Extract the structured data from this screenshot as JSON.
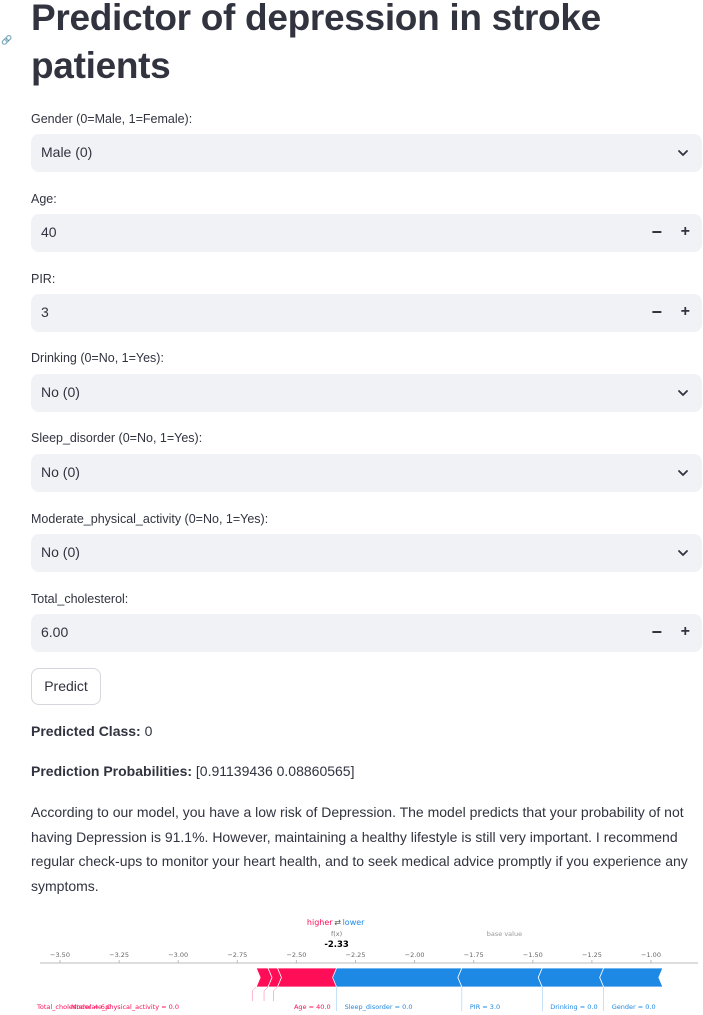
{
  "page": {
    "title": "Predictor of depression in stroke patients"
  },
  "form": {
    "gender": {
      "label": "Gender (0=Male, 1=Female):",
      "value": "Male (0)"
    },
    "age": {
      "label": "Age:",
      "value": "40"
    },
    "pir": {
      "label": "PIR:",
      "value": "3"
    },
    "drinking": {
      "label": "Drinking (0=No, 1=Yes):",
      "value": "No (0)"
    },
    "sleep_disorder": {
      "label": "Sleep_disorder (0=No, 1=Yes):",
      "value": "No (0)"
    },
    "moderate_physical_activity": {
      "label": "Moderate_physical_activity (0=No, 1=Yes):",
      "value": "No (0)"
    },
    "total_cholesterol": {
      "label": "Total_cholesterol:",
      "value": "6.00"
    },
    "stepper_minus": "−",
    "stepper_plus": "+",
    "predict_label": "Predict"
  },
  "result": {
    "class_label": "Predicted Class:",
    "class_value": "0",
    "prob_label": "Prediction Probabilities:",
    "prob_value": "[0.91139436 0.08860565]",
    "advice": "According to our model, you have a low risk of Depression. The model predicts that your probability of not having Depression is 91.1%. However, maintaining a healthy lifestyle is still very important. I recommend regular check-ups to monitor your heart health, and to seek medical advice promptly if you experience any symptoms."
  },
  "chart_data": {
    "type": "force",
    "higher_label": "higher",
    "lower_label": "lower",
    "arrows": "⇄",
    "fx_label": "f(x)",
    "fx_value": "-2.33",
    "base_value_label": "base value",
    "ticks": [
      "−3.50",
      "−3.25",
      "−3.00",
      "−2.75",
      "−2.50",
      "−2.25",
      "−2.00",
      "−1.75",
      "−1.50",
      "−1.25",
      "−1.00"
    ],
    "tick_values": [
      -3.5,
      -3.25,
      -3.0,
      -2.75,
      -2.5,
      -2.25,
      -2.0,
      -1.75,
      -1.5,
      -1.25,
      -1.0
    ],
    "xlim": [
      -3.5,
      -1.0
    ],
    "fx": -2.33,
    "positive_color": "#ff0d57",
    "negative_color": "#1e88e5",
    "features": [
      {
        "label": "Total_cholesterol = 6.0",
        "start": -2.67,
        "end": -2.62,
        "sign": "positive"
      },
      {
        "label": "Moderate_physical_activity = 0.0",
        "start": -2.62,
        "end": -2.58,
        "sign": "positive"
      },
      {
        "label": "Age = 40.0",
        "start": -2.58,
        "end": -2.33,
        "sign": "positive"
      },
      {
        "label": "Sleep_disorder = 0.0",
        "start": -2.33,
        "end": -1.8,
        "sign": "negative"
      },
      {
        "label": "PIR = 3.0",
        "start": -1.8,
        "end": -1.46,
        "sign": "negative"
      },
      {
        "label": "Drinking = 0.0",
        "start": -1.46,
        "end": -1.2,
        "sign": "negative"
      },
      {
        "label": "Gender = 0.0",
        "start": -1.2,
        "end": -0.95,
        "sign": "negative"
      }
    ]
  }
}
